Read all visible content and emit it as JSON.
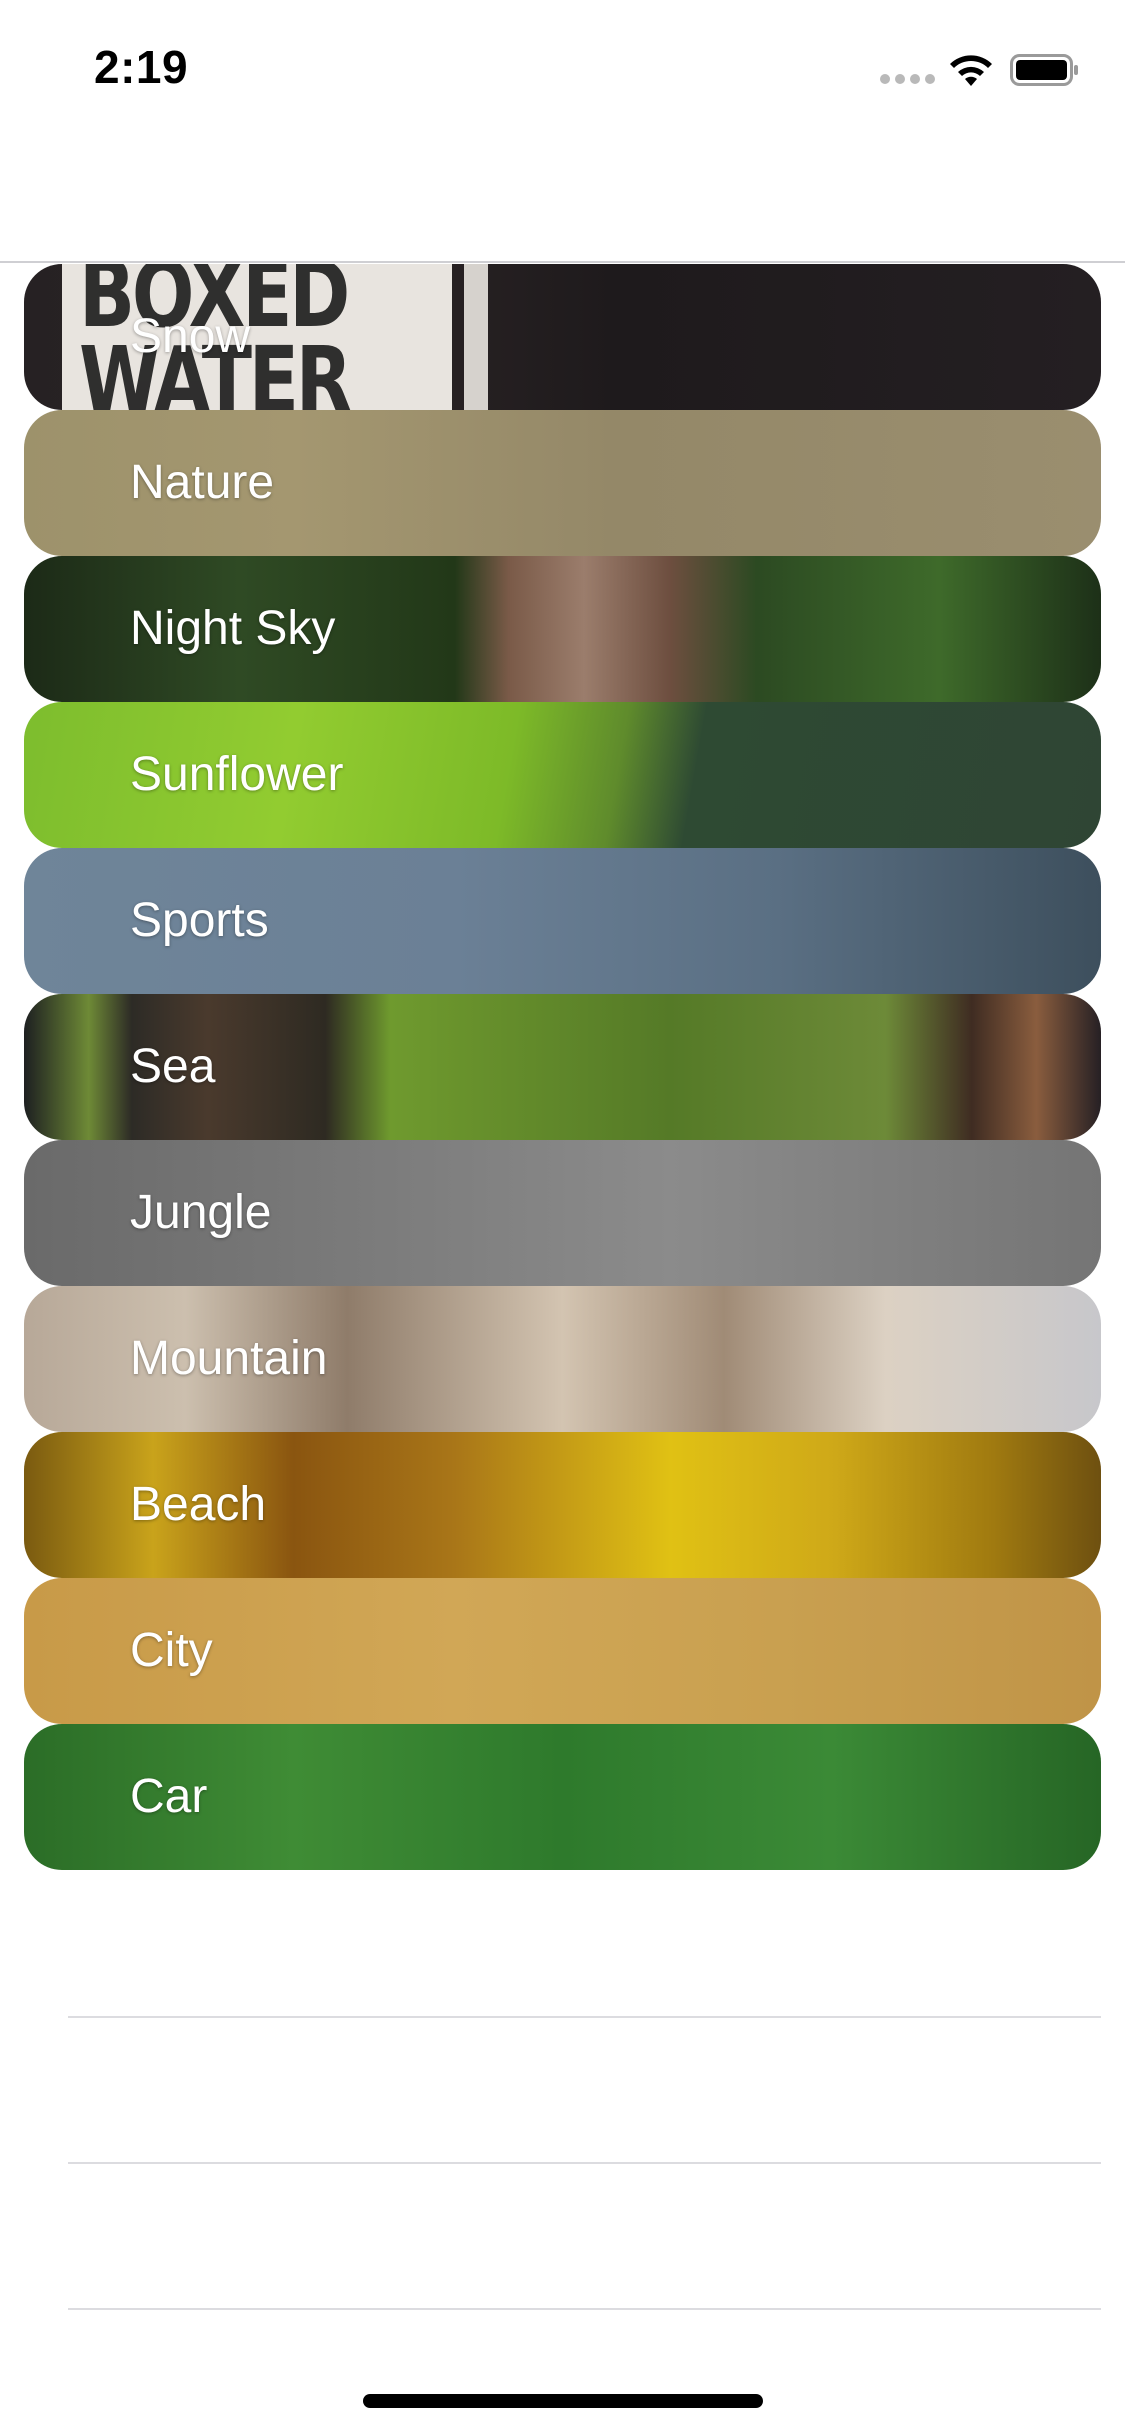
{
  "status_bar": {
    "time": "2:19",
    "icons": [
      "signal-dots-icon",
      "wifi-icon",
      "battery-icon"
    ]
  },
  "categories": [
    {
      "label": "Snow"
    },
    {
      "label": "Nature"
    },
    {
      "label": "Night Sky"
    },
    {
      "label": "Sunflower"
    },
    {
      "label": "Sports"
    },
    {
      "label": "Sea"
    },
    {
      "label": "Jungle"
    },
    {
      "label": "Mountain"
    },
    {
      "label": "Beach"
    },
    {
      "label": "City"
    },
    {
      "label": "Car"
    }
  ],
  "snow_image_sign_text": "BOXED WATER"
}
